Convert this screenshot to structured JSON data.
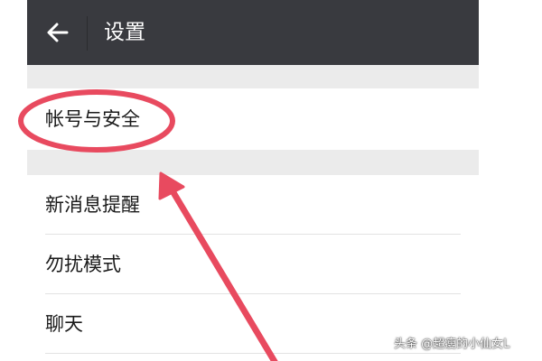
{
  "header": {
    "title": "设置",
    "back_icon": "arrow-left-icon"
  },
  "settings": {
    "items": [
      {
        "label": "帐号与安全"
      },
      {
        "label": "新消息提醒"
      },
      {
        "label": "勿扰模式"
      },
      {
        "label": "聊天"
      }
    ]
  },
  "annotation": {
    "color": "#e84a5f",
    "highlight_icon": "red-ellipse",
    "pointer_icon": "red-arrow"
  },
  "watermark": {
    "text": "头条 @超瘦的小仙女L"
  },
  "colors": {
    "titlebar": "#393a3f",
    "section_gap": "#ebebeb",
    "row_background": "#ffffff",
    "text": "#1a1a1a"
  }
}
